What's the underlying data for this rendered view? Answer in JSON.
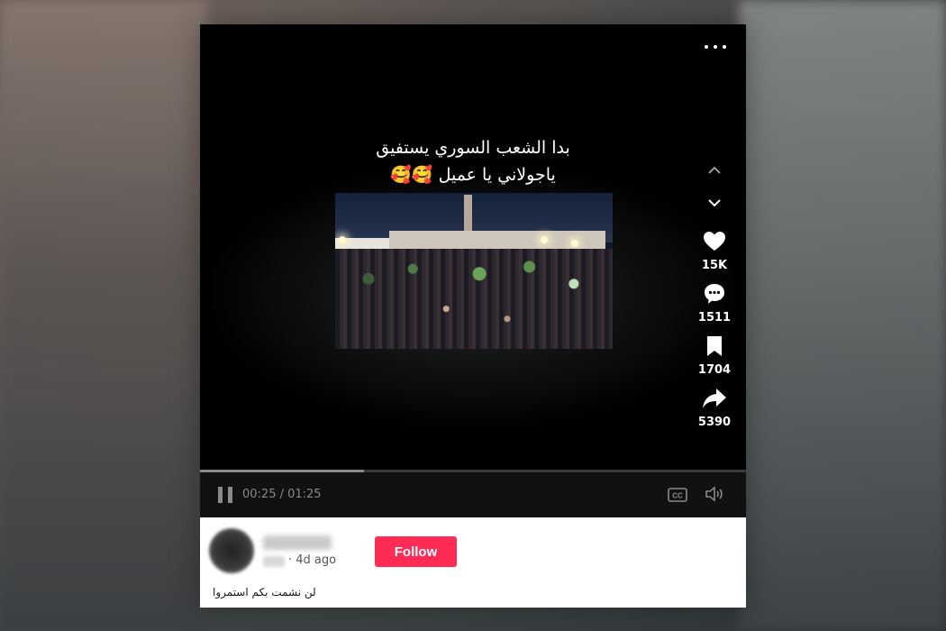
{
  "video": {
    "caption_line1": "بدا الشعب السوري يستفيق",
    "caption_line2": "ياجولاني يا عميل 🥰🥰",
    "more_icon": "more-horizontal-icon"
  },
  "actions": {
    "up_icon": "chevron-up-icon",
    "down_icon": "chevron-down-icon",
    "likes": "15K",
    "comments": "1511",
    "saves": "1704",
    "shares": "5390"
  },
  "player": {
    "current_time": "00:25",
    "duration": "01:25",
    "time_display": "00:25 / 01:25",
    "progress": 0.3,
    "cc_label": "CC"
  },
  "post": {
    "posted": "· 4d ago",
    "follow_label": "Follow",
    "description": "لن نشمت بكم استمروا"
  },
  "colors": {
    "accent": "#fe2c55",
    "video_bg": "#000000",
    "control_gray": "#8a8a8a"
  }
}
